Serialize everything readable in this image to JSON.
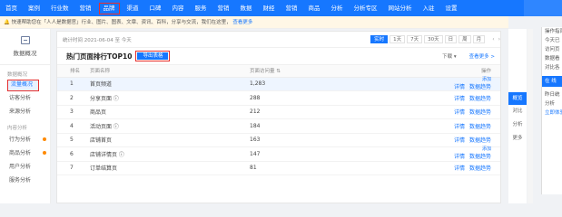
{
  "topnav": {
    "items": [
      "首页",
      "案例",
      "行业数",
      "营销",
      "品牌",
      "渠道",
      "口碑",
      "内容",
      "服务",
      "营销",
      "数据",
      "财经",
      "营销",
      "商品",
      "分析",
      "分析专区",
      "网站分析",
      "入驻",
      "设置"
    ],
    "active_index": 4
  },
  "notice": {
    "text": "快速帮助您在「人人是数据官」行业、图片、图表、文章、资讯、百科，分享与交流，我们在这里，",
    "link": "查看更多"
  },
  "sidebar": {
    "title": "数据概况",
    "group1": "数据概况",
    "items1": [
      {
        "label": "流量概况",
        "active": true,
        "dot": false
      },
      {
        "label": "访客分析",
        "active": false,
        "dot": false
      },
      {
        "label": "来源分析",
        "active": false,
        "dot": false
      }
    ],
    "group2": "内容分析",
    "items2": [
      {
        "label": "行为分析",
        "dot": true
      },
      {
        "label": "商品分析",
        "dot": true
      },
      {
        "label": "用户分析",
        "dot": false
      },
      {
        "label": "服务分析",
        "dot": false
      }
    ]
  },
  "toolbar": {
    "date_text": "统计时间 2021-06-04 至 今天",
    "buttons": [
      "实时",
      "1天",
      "7天",
      "30天",
      "日",
      "周",
      "月"
    ],
    "active_button": 0
  },
  "card": {
    "title": "热门页面排行TOP10",
    "export_label": "导出表格",
    "right_select": "下载 ▾",
    "right_link": "查看更多 >"
  },
  "table": {
    "columns": [
      "排名",
      "页面名称",
      "页面访问量 ⇅",
      "操作"
    ],
    "rows": [
      {
        "rank": "1",
        "name": "首页频道",
        "fav": "1,283",
        "actions": [
          "详情",
          "数据趋势"
        ],
        "sub": "添加",
        "highlight": true
      },
      {
        "rank": "2",
        "name": "分享页面 ⓘ",
        "fav": "288",
        "actions": [
          "详情",
          "数据趋势"
        ],
        "sub": "",
        "highlight": false
      },
      {
        "rank": "3",
        "name": "商品页",
        "fav": "212",
        "actions": [
          "详情",
          "数据趋势"
        ],
        "sub": "",
        "highlight": false
      },
      {
        "rank": "4",
        "name": "活动页面 ⓘ",
        "fav": "184",
        "actions": [
          "详情",
          "数据趋势"
        ],
        "sub": "",
        "highlight": false
      },
      {
        "rank": "5",
        "name": "店铺首页",
        "fav": "163",
        "actions": [
          "详情",
          "数据趋势"
        ],
        "sub": "",
        "highlight": false
      },
      {
        "rank": "6",
        "name": "店铺详情页 ⓘ",
        "fav": "147",
        "actions": [
          "详情",
          "数据趋势"
        ],
        "sub": "添加",
        "highlight": false
      },
      {
        "rank": "7",
        "name": "订单结算页",
        "fav": "81",
        "actions": [
          "详情",
          "数据趋势"
        ],
        "sub": "",
        "highlight": false
      }
    ]
  },
  "rightnav": {
    "active": "概览",
    "items": [
      "对比",
      "分析",
      "更多"
    ]
  },
  "panel": {
    "lines": [
      "操作指南",
      "今天已",
      "访问页",
      "数据看",
      "对比各",
      "昨日统",
      "分析"
    ],
    "box": "在 线",
    "link": "立即体验"
  }
}
